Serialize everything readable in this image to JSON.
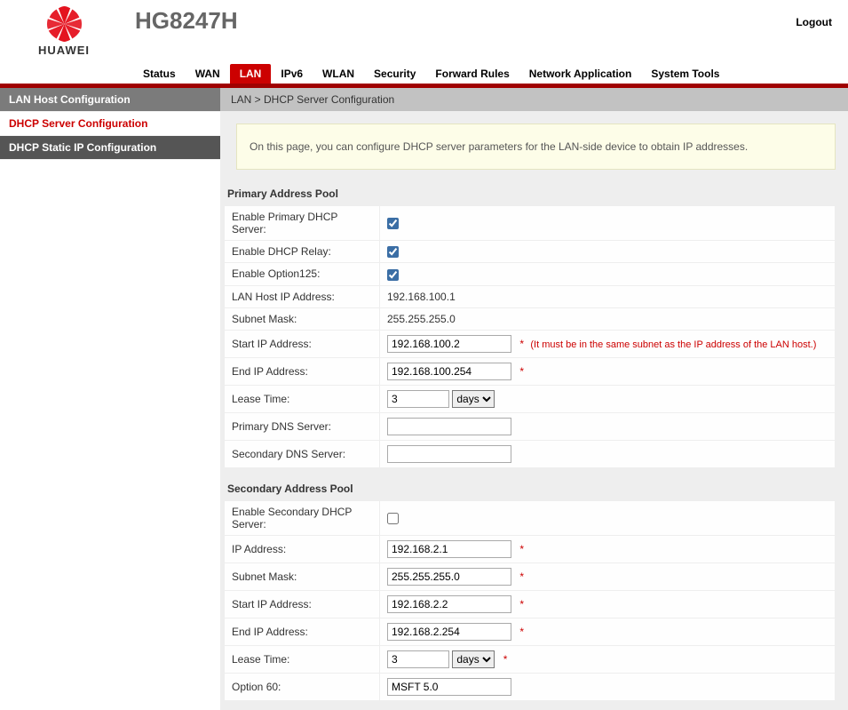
{
  "header": {
    "brand": "HUAWEI",
    "model": "HG8247H",
    "logout": "Logout"
  },
  "nav": {
    "items": [
      "Status",
      "WAN",
      "LAN",
      "IPv6",
      "WLAN",
      "Security",
      "Forward Rules",
      "Network Application",
      "System Tools"
    ],
    "active_index": 2
  },
  "sidebar": {
    "items": [
      {
        "label": "LAN Host Configuration",
        "style": "dark"
      },
      {
        "label": "DHCP Server Configuration",
        "style": "selected"
      },
      {
        "label": "DHCP Static IP Configuration",
        "style": "darker"
      }
    ]
  },
  "breadcrumb": "LAN > DHCP Server Configuration",
  "info_text": "On this page, you can configure DHCP server parameters for the LAN-side device to obtain IP addresses.",
  "primary": {
    "heading": "Primary Address Pool",
    "enable_primary_label": "Enable Primary DHCP Server:",
    "enable_primary_checked": true,
    "enable_relay_label": "Enable DHCP Relay:",
    "enable_relay_checked": true,
    "enable_opt125_label": "Enable Option125:",
    "enable_opt125_checked": true,
    "lan_ip_label": "LAN Host IP Address:",
    "lan_ip_value": "192.168.100.1",
    "subnet_label": "Subnet Mask:",
    "subnet_value": "255.255.255.0",
    "start_ip_label": "Start IP Address:",
    "start_ip_value": "192.168.100.2",
    "start_ip_hint": "(It must be in the same subnet as the IP address of the LAN host.)",
    "end_ip_label": "End IP Address:",
    "end_ip_value": "192.168.100.254",
    "lease_label": "Lease Time:",
    "lease_value": "3",
    "lease_unit": "days",
    "primary_dns_label": "Primary DNS Server:",
    "primary_dns_value": "",
    "secondary_dns_label": "Secondary DNS Server:",
    "secondary_dns_value": ""
  },
  "secondary": {
    "heading": "Secondary Address Pool",
    "enable_label": "Enable Secondary DHCP Server:",
    "enable_checked": false,
    "ip_label": "IP Address:",
    "ip_value": "192.168.2.1",
    "subnet_label": "Subnet Mask:",
    "subnet_value": "255.255.255.0",
    "start_ip_label": "Start IP Address:",
    "start_ip_value": "192.168.2.2",
    "end_ip_label": "End IP Address:",
    "end_ip_value": "192.168.2.254",
    "lease_label": "Lease Time:",
    "lease_value": "3",
    "lease_unit": "days",
    "opt60_label": "Option 60:",
    "opt60_value": "MSFT 5.0"
  },
  "asterisk": "*"
}
